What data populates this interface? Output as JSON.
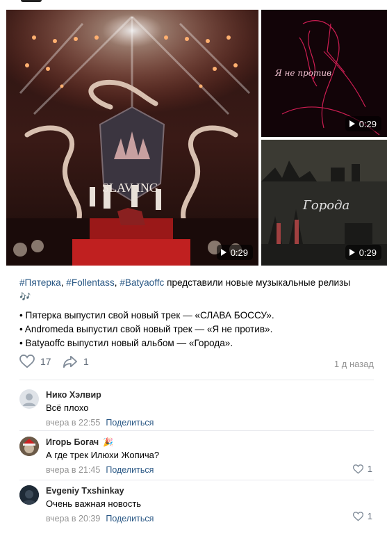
{
  "post": {
    "media": [
      {
        "duration": "0:29",
        "caption": "SLAV ING"
      },
      {
        "duration": "0:29",
        "caption": "Я не против"
      },
      {
        "duration": "0:29",
        "caption": "Города"
      }
    ],
    "text": {
      "tags": [
        "#Пятерка",
        "#Follentass",
        "#Batyaoffc"
      ],
      "sep1": ", ",
      "sep2": ", ",
      "headline_rest": " представили новые музыкальные релизы",
      "emoji": "🎶",
      "bullets": [
        "• Пятерка выпустил свой новый трек — «СЛАВА БОССУ».",
        "• Andromeda выпустил свой новый трек — «Я не против».",
        "• Batyaoffc выпустил новый альбом — «Города»."
      ]
    },
    "likes": "17",
    "shares": "1",
    "time_ago": "1 д назад"
  },
  "comments": [
    {
      "name": "Нико Хэлвир",
      "text": "Всё плохо",
      "time": "вчера в 22:55",
      "share_label": "Поделиться",
      "likes": ""
    },
    {
      "name": "Игорь Богач",
      "badge": "🎉",
      "text": "А где трек Илюхи Жопича?",
      "time": "вчера в 21:45",
      "share_label": "Поделиться",
      "likes": "1"
    },
    {
      "name": "Evgeniy Txshinkay",
      "text": "Очень важная новость",
      "time": "вчера в 20:39",
      "share_label": "Поделиться",
      "likes": "1"
    }
  ],
  "colors": {
    "link": "#2a5885",
    "muted": "#939393",
    "accent_red": "#c0283a"
  }
}
